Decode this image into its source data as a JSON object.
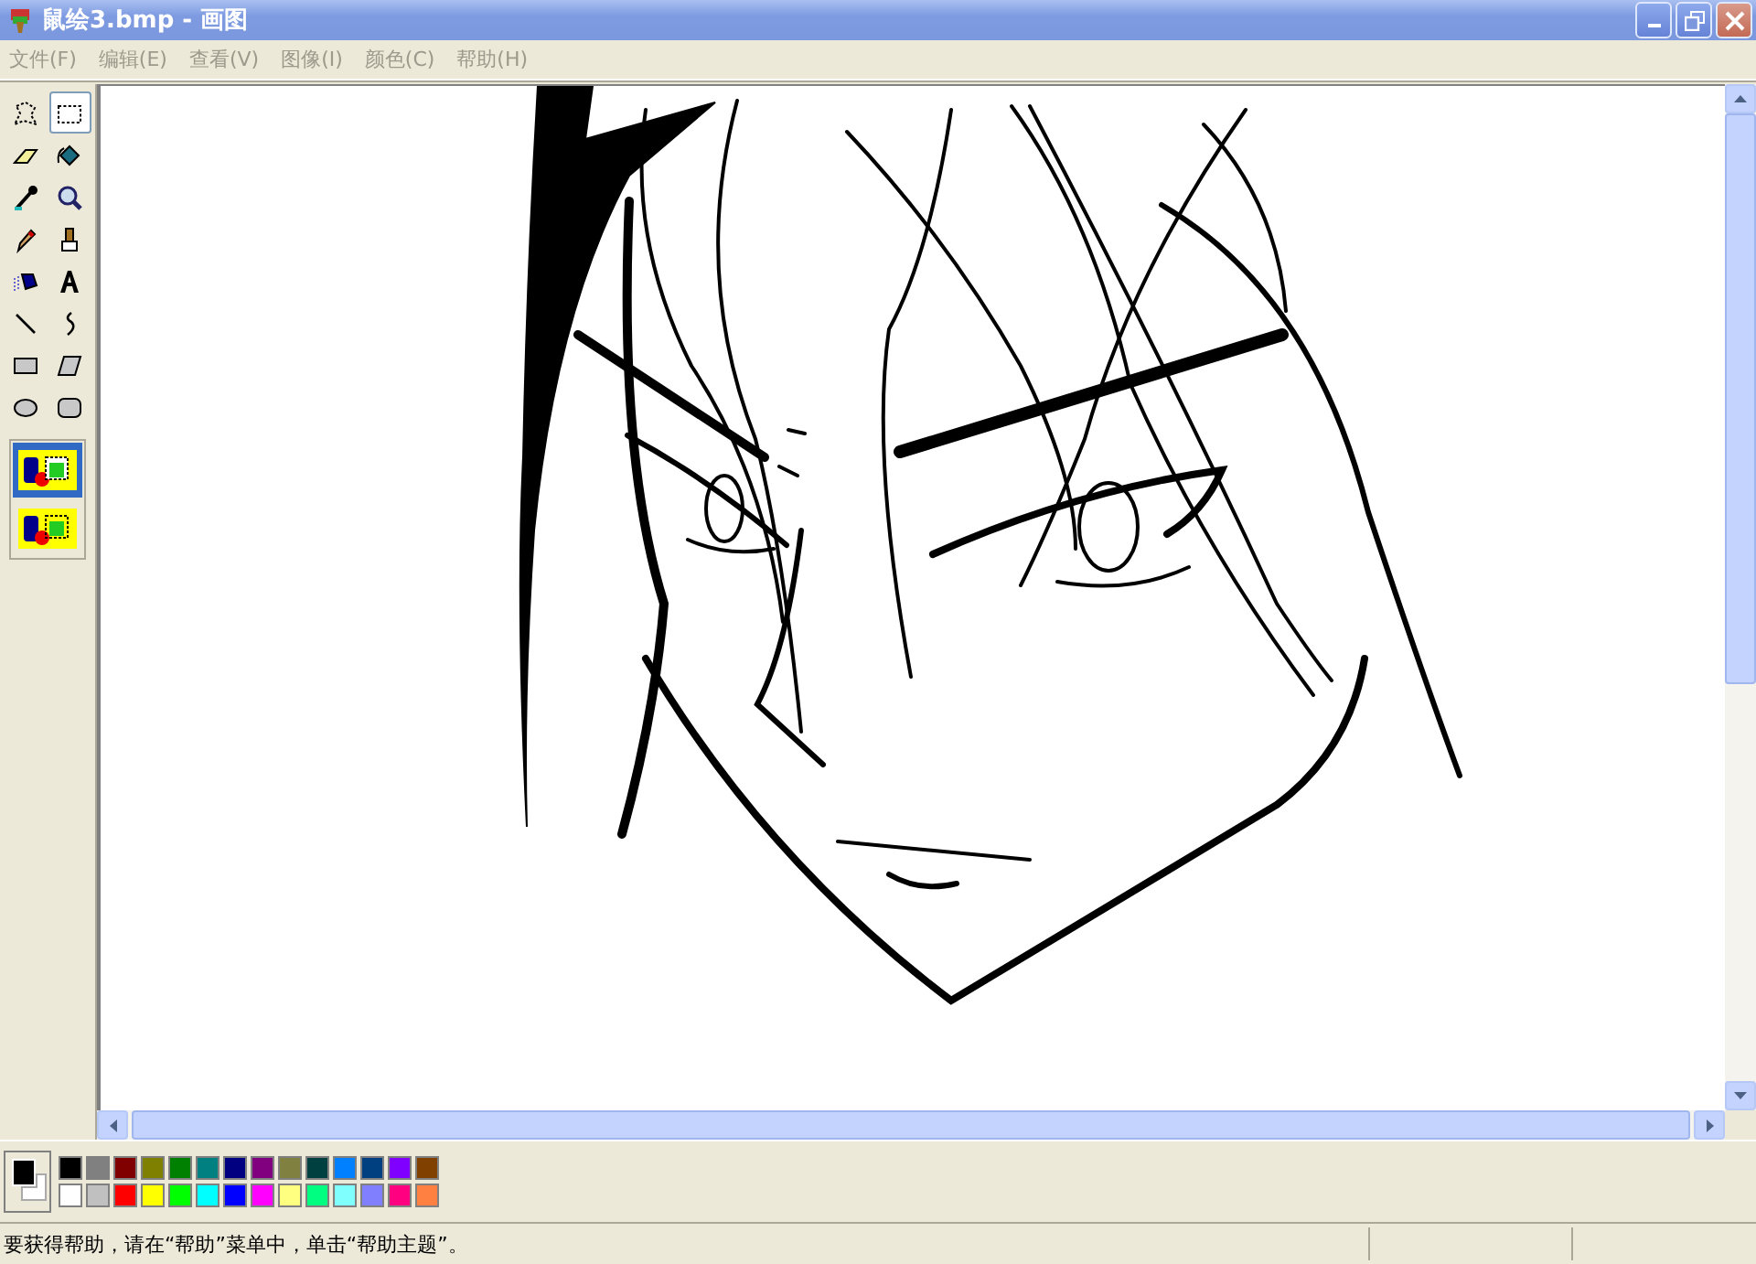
{
  "window": {
    "title": "鼠绘3.bmp - 画图"
  },
  "menu": [
    "文件(F)",
    "编辑(E)",
    "查看(V)",
    "图像(I)",
    "颜色(C)",
    "帮助(H)"
  ],
  "tools": [
    {
      "selected": false
    },
    {
      "selected": true
    },
    {
      "selected": false
    },
    {
      "selected": false
    },
    {
      "selected": false
    },
    {
      "selected": false
    },
    {
      "selected": false
    },
    {
      "selected": false
    },
    {
      "selected": false
    },
    {
      "selected": false
    },
    {
      "selected": false
    },
    {
      "selected": false
    },
    {
      "selected": false
    },
    {
      "selected": false
    },
    {
      "selected": false
    },
    {
      "selected": false
    }
  ],
  "tool_options": [
    {
      "selected": true
    },
    {
      "selected": false
    }
  ],
  "current_colors": [
    {
      "color": "#000000"
    },
    {
      "color": "#ffffff"
    }
  ],
  "palette": [
    {
      "color": "#000000"
    },
    {
      "color": "#808080"
    },
    {
      "color": "#800000"
    },
    {
      "color": "#808000"
    },
    {
      "color": "#008000"
    },
    {
      "color": "#008080"
    },
    {
      "color": "#000080"
    },
    {
      "color": "#800080"
    },
    {
      "color": "#808040"
    },
    {
      "color": "#004040"
    },
    {
      "color": "#0080ff"
    },
    {
      "color": "#004080"
    },
    {
      "color": "#8000ff"
    },
    {
      "color": "#804000"
    },
    {
      "color": "#ffffff"
    },
    {
      "color": "#c0c0c0"
    },
    {
      "color": "#ff0000"
    },
    {
      "color": "#ffff00"
    },
    {
      "color": "#00ff00"
    },
    {
      "color": "#00ffff"
    },
    {
      "color": "#0000ff"
    },
    {
      "color": "#ff00ff"
    },
    {
      "color": "#ffff80"
    },
    {
      "color": "#00ff80"
    },
    {
      "color": "#80ffff"
    },
    {
      "color": "#8080ff"
    },
    {
      "color": "#ff0080"
    },
    {
      "color": "#ff8040"
    }
  ],
  "status_bar": {
    "text": "要获得帮助，请在“帮助”菜单中，单击“帮助主题”。"
  }
}
